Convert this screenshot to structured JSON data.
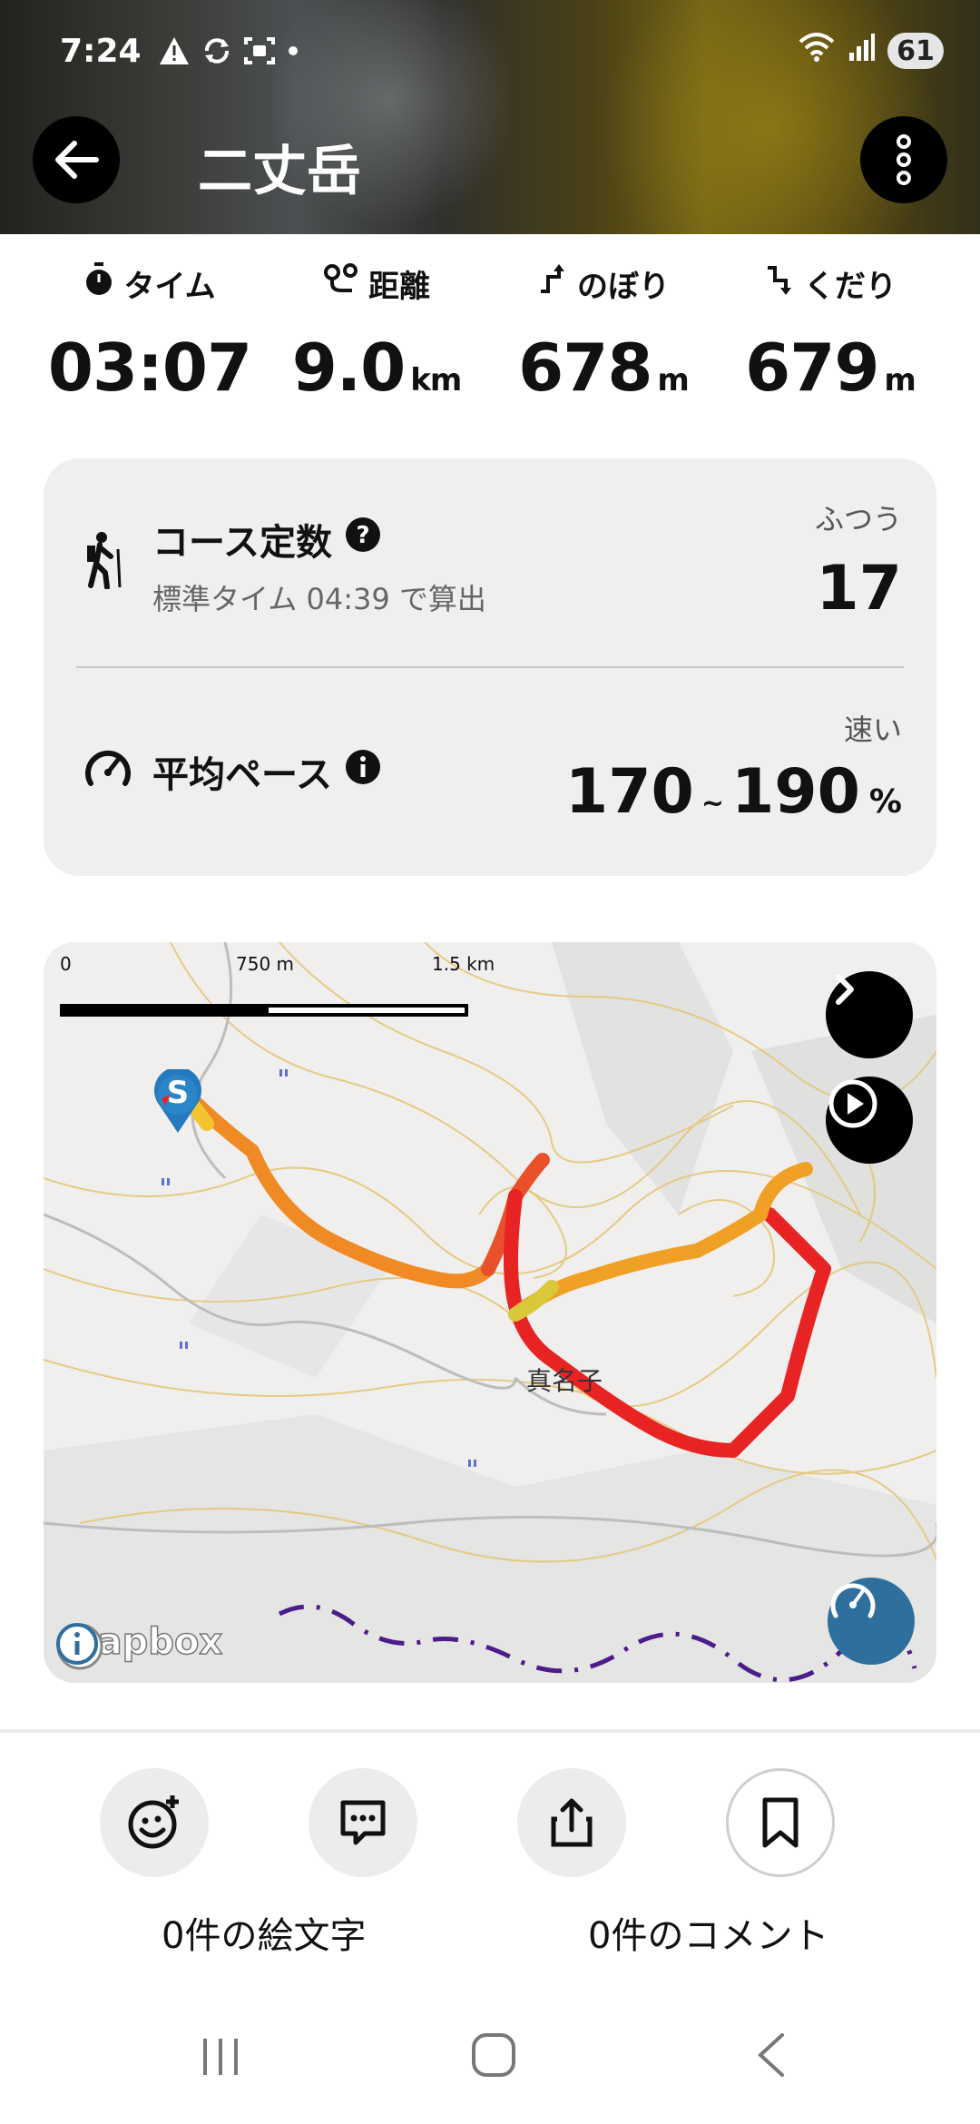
{
  "status_bar": {
    "time": "7:24",
    "battery": "61"
  },
  "header": {
    "title": "二丈岳"
  },
  "stats": [
    {
      "label": "タイム",
      "value": "03:07",
      "unit": ""
    },
    {
      "label": "距離",
      "value": "9.0",
      "unit": "km"
    },
    {
      "label": "のぼり",
      "value": "678",
      "unit": "m"
    },
    {
      "label": "くだり",
      "value": "679",
      "unit": "m"
    }
  ],
  "course_constant": {
    "title": "コース定数",
    "subtitle": "標準タイム 04:39 で算出",
    "tag": "ふつう",
    "value": "17"
  },
  "average_pace": {
    "title": "平均ペース",
    "tag": "速い",
    "min": "170",
    "separator": "~",
    "max": "190",
    "unit": "%"
  },
  "map": {
    "scale_labels": [
      "0",
      "750 m",
      "1.5 km"
    ],
    "place_label": "真名子",
    "start_marker": "S",
    "attribution": "mapbox",
    "route_colors": [
      "#f4c430",
      "#f08a24",
      "#e82323"
    ]
  },
  "actions": {
    "emoji_count": "0件の絵文字",
    "comment_count": "0件のコメント"
  }
}
